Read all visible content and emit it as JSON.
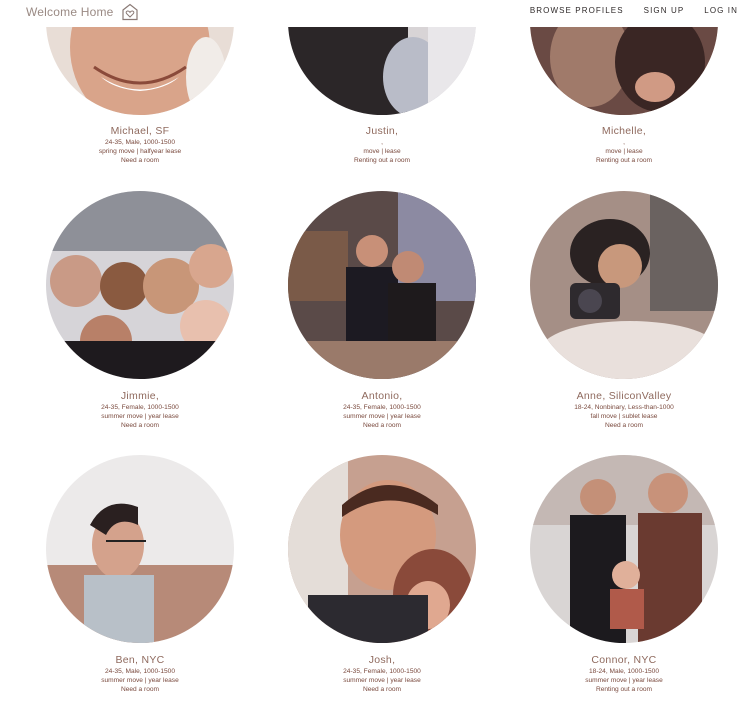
{
  "nav": {
    "brand": "Welcome Home",
    "links": [
      "BROWSE PROFILES",
      "SIGN UP",
      "LOG IN"
    ]
  },
  "profiles": [
    {
      "name": "Michael, SF",
      "info": "24-35, Male, 1000-1500",
      "move": "spring move | halfyear lease",
      "status": "Need a room"
    },
    {
      "name": "Justin,",
      "info": ",",
      "move": "move | lease",
      "status": "Renting out a room"
    },
    {
      "name": "Michelle,",
      "info": ",",
      "move": "move | lease",
      "status": "Renting out a room"
    },
    {
      "name": "Jimmie,",
      "info": "24-35, Female, 1000-1500",
      "move": "summer move | year lease",
      "status": "Need a room"
    },
    {
      "name": "Antonio,",
      "info": "24-35, Female, 1000-1500",
      "move": "summer move | year lease",
      "status": "Need a room"
    },
    {
      "name": "Anne, SiliconValley",
      "info": "18-24, Nonbinary, Less-than-1000",
      "move": "fall move | sublet lease",
      "status": "Need a room"
    },
    {
      "name": "Ben, NYC",
      "info": "24-35, Male, 1000-1500",
      "move": "summer move | year lease",
      "status": "Need a room"
    },
    {
      "name": "Josh,",
      "info": "24-35, Female, 1000-1500",
      "move": "summer move | year lease",
      "status": "Need a room"
    },
    {
      "name": "Connor, NYC",
      "info": "18-24, Male, 1000-1500",
      "move": "summer move | year lease",
      "status": "Renting out a room"
    }
  ]
}
